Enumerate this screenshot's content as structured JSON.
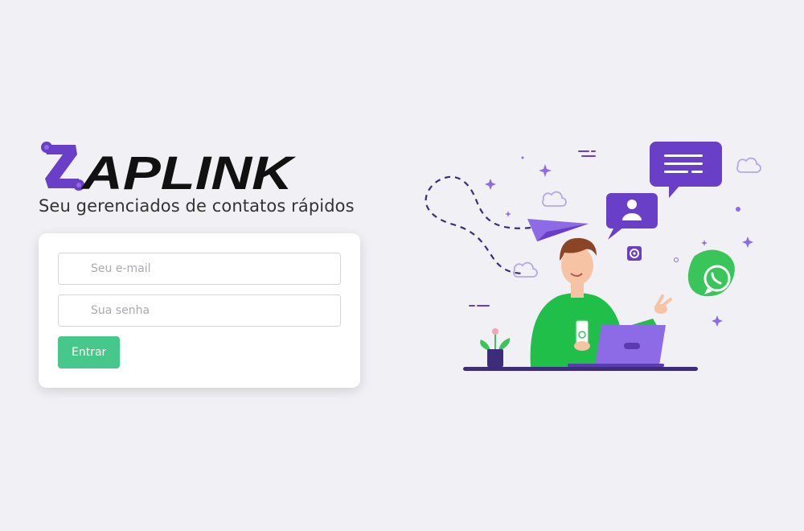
{
  "brand": {
    "logo_text": "ZAPLINK",
    "tagline": "Seu gerenciados de contatos rápidos",
    "accent_color": "#6a3fc8"
  },
  "login_form": {
    "email_placeholder": "Seu e-mail",
    "password_placeholder": "Sua senha",
    "submit_label": "Entrar",
    "submit_color": "#45c88a"
  },
  "illustration": {
    "icons": [
      "paper-plane-icon",
      "chat-bubble-icon",
      "user-card-icon",
      "gear-icon",
      "whatsapp-icon",
      "cloud-icon",
      "sparkle-icon",
      "plant-icon",
      "laptop-icon",
      "phone-icon"
    ]
  }
}
